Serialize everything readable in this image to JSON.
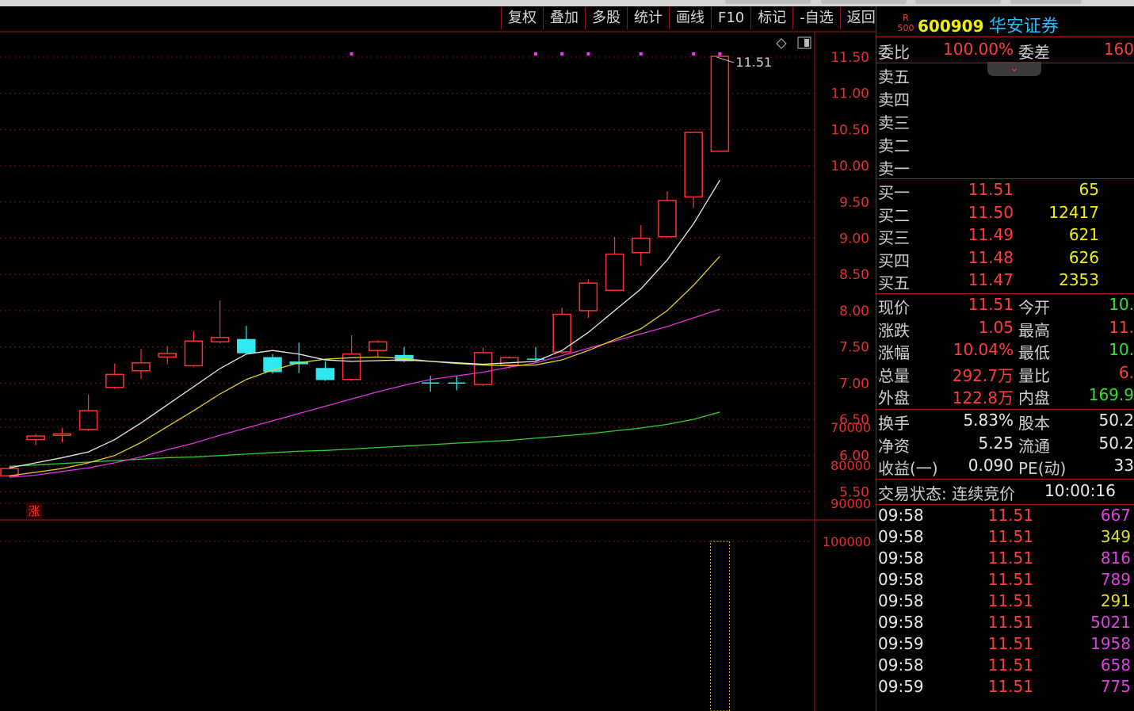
{
  "toolbar": [
    "复权",
    "叠加",
    "多股",
    "统计",
    "画线",
    "F10",
    "标记",
    "-自选",
    "返回"
  ],
  "stock": {
    "code": "600909",
    "name": "华安证券",
    "badge_top": "R",
    "badge_bottom": "500"
  },
  "weibi": {
    "label1": "委比",
    "value1": "100.00%",
    "label2": "委差",
    "value2": "160"
  },
  "sell_labels": [
    "卖五",
    "卖四",
    "卖三",
    "卖二",
    "卖一"
  ],
  "buy": [
    {
      "label": "买一",
      "price": "11.51",
      "vol": "65"
    },
    {
      "label": "买二",
      "price": "11.50",
      "vol": "12417"
    },
    {
      "label": "买三",
      "price": "11.49",
      "vol": "621"
    },
    {
      "label": "买四",
      "price": "11.48",
      "vol": "626"
    },
    {
      "label": "买五",
      "price": "11.47",
      "vol": "2353"
    }
  ],
  "stats": [
    {
      "l1": "现价",
      "v1": "11.51",
      "l2": "今开",
      "v2": "10.",
      "c2": "#30e030"
    },
    {
      "l1": "涨跌",
      "v1": "1.05",
      "l2": "最高",
      "v2": "11.",
      "c2": "#ff3b3b"
    },
    {
      "l1": "涨幅",
      "v1": "10.04%",
      "l2": "最低",
      "v2": "10.",
      "c2": "#30e030"
    },
    {
      "l1": "总量",
      "v1": "292.7万",
      "l2": "量比",
      "v2": "6.",
      "c2": "#ff3b3b"
    },
    {
      "l1": "外盘",
      "v1": "122.8万",
      "l2": "内盘",
      "v2": "169.9",
      "c2": "#30e030"
    }
  ],
  "fund": [
    {
      "l1": "换手",
      "v1": "5.83%",
      "l2": "股本",
      "v2": "50.2"
    },
    {
      "l1": "净资",
      "v1": "5.25",
      "l2": "流通",
      "v2": "50.2"
    },
    {
      "l1": "收益(一)",
      "v1": "0.090",
      "l2": "PE(动)",
      "v2": "33"
    }
  ],
  "status": {
    "label": "交易状态: 连续竞价",
    "time": "10:00:16"
  },
  "ticks": [
    {
      "t": "09:58",
      "p": "11.51",
      "v": "667",
      "c": "#e040e0"
    },
    {
      "t": "09:58",
      "p": "11.51",
      "v": "349",
      "c": "#e0e020"
    },
    {
      "t": "09:58",
      "p": "11.51",
      "v": "816",
      "c": "#e040e0"
    },
    {
      "t": "09:58",
      "p": "11.51",
      "v": "789",
      "c": "#e040e0"
    },
    {
      "t": "09:58",
      "p": "11.51",
      "v": "291",
      "c": "#e0e020"
    },
    {
      "t": "09:58",
      "p": "11.51",
      "v": "5021",
      "c": "#e040e0"
    },
    {
      "t": "09:59",
      "p": "11.51",
      "v": "1958",
      "c": "#e040e0"
    },
    {
      "t": "09:58",
      "p": "11.51",
      "v": "658",
      "c": "#e040e0"
    },
    {
      "t": "09:59",
      "p": "11.51",
      "v": "775",
      "c": "#e040e0"
    }
  ],
  "chart": {
    "price_ticks": [
      "11.50",
      "11.00",
      "10.50",
      "10.00",
      "9.50",
      "9.00",
      "8.50",
      "8.00",
      "7.50",
      "7.00",
      "6.50",
      "6.00",
      "5.50"
    ],
    "price_values": [
      11.5,
      11.0,
      10.5,
      10.0,
      9.5,
      9.0,
      8.5,
      8.0,
      7.5,
      7.0,
      6.5,
      6.0,
      5.5
    ],
    "vol_ticks": [
      "100000",
      "90000",
      "80000",
      "70000"
    ],
    "vol_values": [
      100000,
      90000,
      80000,
      70000
    ],
    "high_label": "11.51",
    "limit_up_mark": "涨",
    "candles": [
      {
        "o": 5.72,
        "c": 5.82,
        "h": 5.85,
        "l": 5.7
      },
      {
        "o": 6.22,
        "c": 6.27,
        "h": 6.3,
        "l": 6.14
      },
      {
        "o": 6.28,
        "c": 6.3,
        "h": 6.38,
        "l": 6.18
      },
      {
        "o": 6.36,
        "c": 6.62,
        "h": 6.84,
        "l": 6.34
      },
      {
        "o": 6.94,
        "c": 7.12,
        "h": 7.27,
        "l": 6.92
      },
      {
        "o": 7.17,
        "c": 7.28,
        "h": 7.47,
        "l": 7.06
      },
      {
        "o": 7.36,
        "c": 7.41,
        "h": 7.51,
        "l": 7.26
      },
      {
        "o": 7.24,
        "c": 7.58,
        "h": 7.72,
        "l": 7.22
      },
      {
        "o": 7.57,
        "c": 7.63,
        "h": 8.14,
        "l": 7.55
      },
      {
        "o": 7.6,
        "c": 7.42,
        "h": 7.79,
        "l": 7.41
      },
      {
        "o": 7.35,
        "c": 7.16,
        "h": 7.4,
        "l": 7.13
      },
      {
        "o": 7.29,
        "c": 7.28,
        "h": 7.56,
        "l": 7.14
      },
      {
        "o": 7.2,
        "c": 7.05,
        "h": 7.3,
        "l": 7.03
      },
      {
        "o": 7.05,
        "c": 7.4,
        "h": 7.66,
        "l": 7.03
      },
      {
        "o": 7.45,
        "c": 7.57,
        "h": 7.59,
        "l": 7.36
      },
      {
        "o": 7.38,
        "c": 7.31,
        "h": 7.5,
        "l": 7.29
      },
      {
        "o": 7.0,
        "c": 7.0,
        "h": 7.1,
        "l": 6.88
      },
      {
        "o": 7.0,
        "c": 7.0,
        "h": 7.1,
        "l": 6.9
      },
      {
        "o": 6.98,
        "c": 7.42,
        "h": 7.49,
        "l": 6.96
      },
      {
        "o": 7.25,
        "c": 7.35,
        "h": 7.37,
        "l": 7.2
      },
      {
        "o": 7.33,
        "c": 7.33,
        "h": 7.5,
        "l": 7.3
      },
      {
        "o": 7.43,
        "c": 7.95,
        "h": 8.04,
        "l": 7.4
      },
      {
        "o": 8.0,
        "c": 8.38,
        "h": 8.43,
        "l": 7.9
      },
      {
        "o": 8.28,
        "c": 8.78,
        "h": 9.02,
        "l": 8.27
      },
      {
        "o": 8.8,
        "c": 9.0,
        "h": 9.18,
        "l": 8.62
      },
      {
        "o": 9.02,
        "c": 9.52,
        "h": 9.65,
        "l": 9.01
      },
      {
        "o": 9.57,
        "c": 10.46,
        "h": 10.46,
        "l": 9.42
      },
      {
        "o": 10.2,
        "c": 11.51,
        "h": 11.51,
        "l": 10.2
      }
    ],
    "ma_white": [
      5.83,
      5.9,
      5.97,
      6.05,
      6.22,
      6.45,
      6.7,
      6.95,
      7.2,
      7.4,
      7.45,
      7.4,
      7.32,
      7.3,
      7.31,
      7.32,
      7.3,
      7.28,
      7.26,
      7.28,
      7.3,
      7.45,
      7.7,
      8.0,
      8.3,
      8.7,
      9.2,
      9.8
    ],
    "ma_yellow": [
      5.72,
      5.77,
      5.82,
      5.9,
      6.0,
      6.18,
      6.4,
      6.62,
      6.85,
      7.05,
      7.18,
      7.28,
      7.33,
      7.35,
      7.36,
      7.34,
      7.3,
      7.27,
      7.25,
      7.24,
      7.25,
      7.32,
      7.45,
      7.6,
      7.75,
      8.0,
      8.35,
      8.75
    ],
    "ma_magenta": [
      5.7,
      5.73,
      5.78,
      5.83,
      5.9,
      5.98,
      6.08,
      6.17,
      6.28,
      6.38,
      6.48,
      6.58,
      6.68,
      6.78,
      6.88,
      6.97,
      7.05,
      7.1,
      7.15,
      7.22,
      7.28,
      7.38,
      7.48,
      7.58,
      7.68,
      7.78,
      7.9,
      8.02
    ],
    "ma_green": [
      5.85,
      5.87,
      5.89,
      5.91,
      5.93,
      5.95,
      5.97,
      5.98,
      6.0,
      6.02,
      6.04,
      6.06,
      6.07,
      6.09,
      6.11,
      6.13,
      6.15,
      6.17,
      6.19,
      6.21,
      6.24,
      6.27,
      6.3,
      6.34,
      6.38,
      6.43,
      6.5,
      6.6
    ],
    "last_volume": 100000
  }
}
